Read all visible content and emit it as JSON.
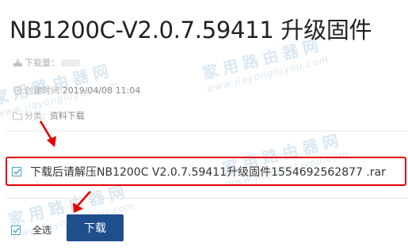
{
  "page": {
    "title": "NB1200C-V2.0.7.59411 升级固件"
  },
  "meta": {
    "views_label": "下载量：",
    "created_label": "创建时间:",
    "created_value": "2019/04/08 11:04",
    "category_label": "分类:",
    "category_value": "资料下载"
  },
  "file": {
    "name": "下载后请解压NB1200C V2.0.7.59411升级固件1554692562877 .rar",
    "checked": true
  },
  "actions": {
    "select_all_label": "全选",
    "download_label": "下载"
  },
  "watermark": {
    "title": "家用路由器网",
    "url": "www.jiayongluyou.com"
  },
  "colors": {
    "accent": "#1f4e8c",
    "highlight_border": "#e60000",
    "checkbox": "#4aa3c7",
    "watermark": "#d7e6f2"
  }
}
